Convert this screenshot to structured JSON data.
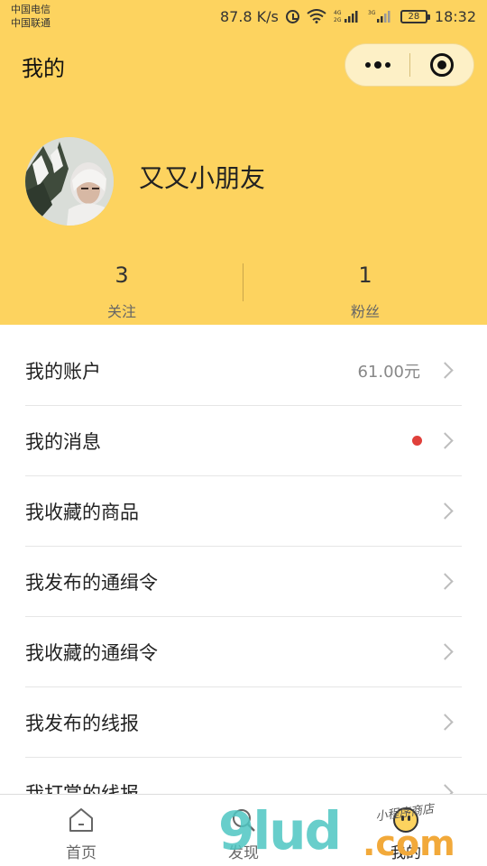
{
  "status_bar": {
    "carrier_1": "中国电信",
    "carrier_2": "中国联通",
    "speed": "87.8 K/s",
    "net_1": "4G\n2G",
    "net_2": "3G",
    "battery": "28",
    "time": "18:32"
  },
  "header": {
    "title": "我的",
    "accent_color": "#fdd35f"
  },
  "profile": {
    "nickname": "又又小朋友",
    "following_count": "3",
    "following_label": "关注",
    "followers_count": "1",
    "followers_label": "粉丝"
  },
  "menu": {
    "items": [
      {
        "label": "我的账户",
        "extra": "61.00元"
      },
      {
        "label": "我的消息",
        "badge": "red-dot"
      },
      {
        "label": "我收藏的商品"
      },
      {
        "label": "我发布的通缉令"
      },
      {
        "label": "我收藏的通缉令"
      },
      {
        "label": "我发布的线报"
      },
      {
        "label": "我打赏的线报"
      }
    ]
  },
  "tabbar": {
    "tabs": [
      {
        "label": "首页",
        "icon": "home-icon"
      },
      {
        "label": "发现",
        "icon": "search-icon"
      },
      {
        "label": "我的",
        "icon": "profile-face-icon",
        "active": true
      }
    ]
  },
  "watermark": {
    "main": "9lud",
    "suffix": ".com",
    "small": "小程序商店"
  }
}
